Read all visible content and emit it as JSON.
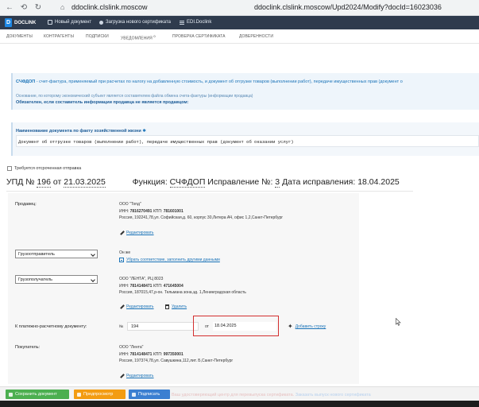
{
  "browser": {
    "back_icon": "arrow-left-icon",
    "url_short": "ddoclink.clslink.moscow",
    "url_full": "ddoclink.clslink.moscow/Upd2024/Modify?docId=16023036"
  },
  "header": {
    "brand": "DOCLINK",
    "links": [
      {
        "label": "Новый документ",
        "icon": "document-icon"
      },
      {
        "label": "Загрузка нового сертификата",
        "icon": "gear-icon"
      },
      {
        "label": "EDI.Doclink",
        "icon": "menu-icon"
      }
    ]
  },
  "nav": {
    "items": [
      "ДОКУМЕНТЫ",
      "КОНТРАГЕНТЫ",
      "ПОДПИСКИ",
      "УВЕДОМЛЕНИЯ",
      "ПРОВЕРКА СЕРТИФИКАТА",
      "ДОВЕРЕННОСТИ"
    ],
    "notifications_count": "0"
  },
  "info": {
    "title_bold": "СЧФДОП",
    "title_rest": " - счет-фактура, применяемый при расчетах по налогу на добавленную стоимость, и документ об отгрузке товаров (выполнении работ), передаче имущественных прав (документ о",
    "note": "Основание, по которому экономический субъект является составителем файла обмена счета-фактуры (информации продавца)",
    "mandatory": "Обязателен, если составитель информации продавца не является продавцом:"
  },
  "name_field": {
    "label": "Наименование документа по факту хозяйственной жизни",
    "star": "✱",
    "value": "Документ об отгрузке товаров (выполнении работ), передаче имущественных прав (документ об оказании услуг)"
  },
  "checkbox": {
    "label": "Требуется отсроченная отправка"
  },
  "doc": {
    "prefix": "УПД №",
    "number": "196",
    "from": "от",
    "date": "21.03.2025",
    "function_label": "Функция:",
    "function_value": "СЧФДОП",
    "correction_label": "Исправление №:",
    "correction_value": "3",
    "correction_date_label": "Дата исправления:",
    "correction_date": "18.04.2025"
  },
  "seller": {
    "label": "Продавец:",
    "name": "ООО \"Топд\"",
    "inn_label": "ИНН:",
    "inn": "7816270491",
    "kpp_label": "КПП:",
    "kpp": "781601001",
    "address": "Россия, 192241,78,ул. Софийская,д. 60, корпус 30,Литера АЧ, офис 1,2,Санкт-Петербург",
    "edit": "Редактировать"
  },
  "shipper": {
    "select": "Грузоотправитель",
    "same": "Он же",
    "remove": "Убрать соответствие, заполнить другими данными"
  },
  "consignee": {
    "select": "Грузополучатель",
    "name": "ООО \"ЛЕНТА\", РЦ 8023",
    "inn_label": "ИНН:",
    "inn": "7814148471",
    "kpp_label": "КПП:",
    "kpp": "471645004",
    "address": "Россия, 187015,47,р-он. Тельмана зона,зд. 1,Ленинградская область",
    "edit": "Редактировать",
    "delete": "Удалить"
  },
  "payment": {
    "label": "К платежно-расчетному документу:",
    "num_label": "№",
    "num": "194",
    "date_label": "от",
    "date": "18.04.2025",
    "add_row": "Добавить строку"
  },
  "buyer": {
    "label": "Покупатель:",
    "name": "ООО \"Лента\"",
    "inn_label": "ИНН:",
    "inn": "7814148471",
    "kpp_label": "КПП:",
    "kpp": "997350001",
    "address": "Россия, 197374,78,ул. Савушкина,112,лит. Б,Санкт-Петербург",
    "edit": "Редактировать"
  },
  "bottom": {
    "save": "Сохранить документ",
    "preview": "Предпросмотр",
    "sign": "Подписать",
    "hint_left": "Ваш удостоверяющий центр для перевыпуска сертификата.",
    "hint_link": "Заказать выпуск нового сертификата"
  }
}
